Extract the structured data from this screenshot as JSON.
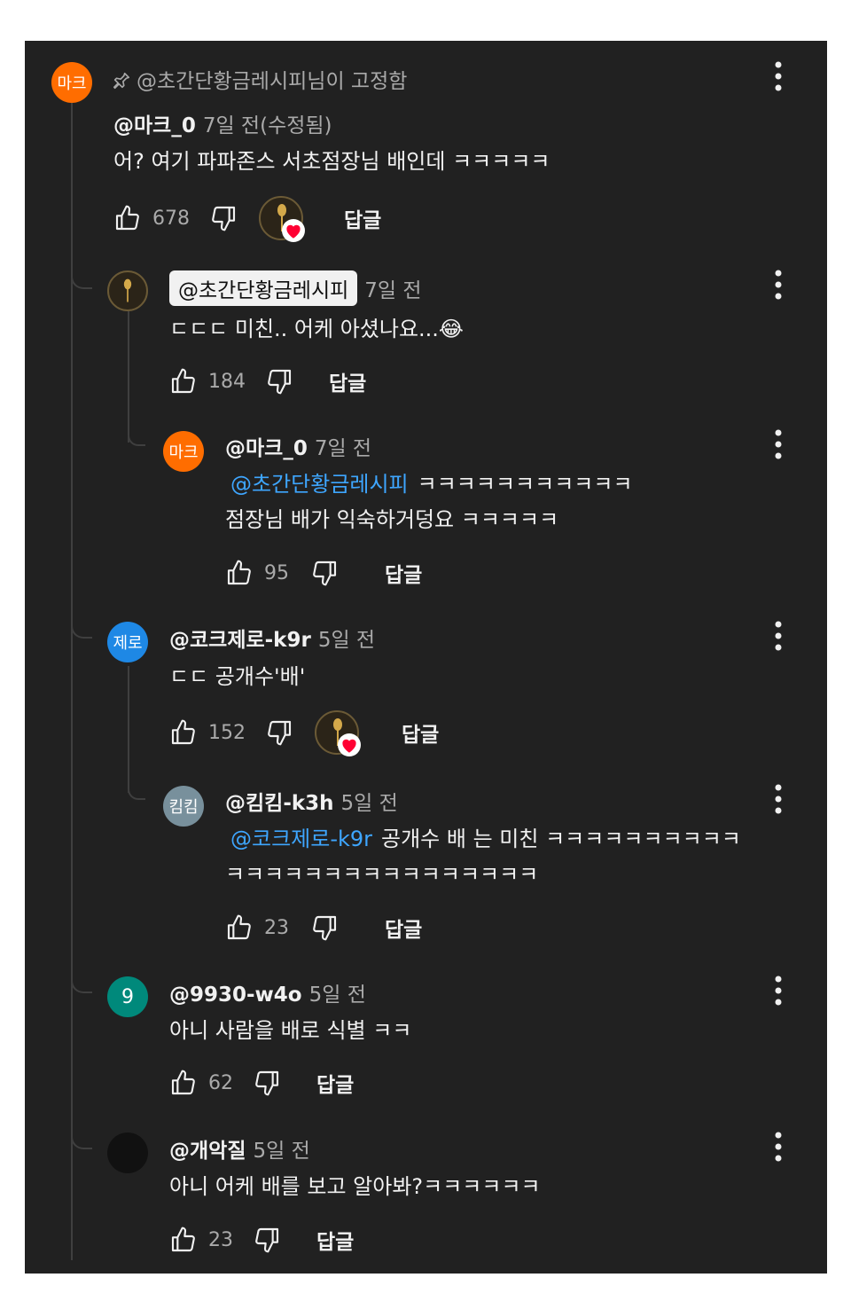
{
  "pinned": {
    "text": "@초간단황금레시피님이 고정함"
  },
  "comments": [
    {
      "avatar_text": "마크",
      "avatar_color": "#ff6d00",
      "handle": "@마크_0",
      "time": "7일 전(수정됨)",
      "text": "어? 여기 파파존스 서초점장님 배인데 ㅋㅋㅋㅋㅋ",
      "likes": "678",
      "reply_label": "답글",
      "creator_heart": true
    },
    {
      "avatar_text": "",
      "avatar_color": "#2b2418",
      "handle": "@초간단황금레시피",
      "time": "7일 전",
      "text": "ㄷㄷㄷ 미친.. 어케 아셨나요...😂",
      "likes": "184",
      "reply_label": "답글",
      "creator_heart": false
    },
    {
      "avatar_text": "마크",
      "avatar_color": "#ff6d00",
      "handle": "@마크_0",
      "time": "7일 전",
      "mention": "@초간단황금레시피",
      "text_line1": "ㅋㅋㅋㅋㅋㅋㅋㅋㅋㅋㅋ",
      "text_line2": "점장님 배가 익숙하거덩요 ㅋㅋㅋㅋㅋ",
      "likes": "95",
      "reply_label": "답글",
      "creator_heart": false
    },
    {
      "avatar_text": "제로",
      "avatar_color": "#1e88e5",
      "handle": "@코크제로-k9r",
      "time": "5일 전",
      "text": "ㄷㄷ 공개수'배'",
      "likes": "152",
      "reply_label": "답글",
      "creator_heart": true
    },
    {
      "avatar_text": "킴킴",
      "avatar_color": "#78909c",
      "handle": "@킴킴-k3h",
      "time": "5일 전",
      "mention": "@코크제로-k9r",
      "text_line1": "공개수 배 는 미친 ㅋㅋㅋㅋㅋㅋㅋㅋㅋㅋ",
      "text_line2": "ㅋㅋㅋㅋㅋㅋㅋㅋㅋㅋㅋㅋㅋㅋㅋㅋ",
      "likes": "23",
      "reply_label": "답글",
      "creator_heart": false
    },
    {
      "avatar_text": "9",
      "avatar_color": "#00897b",
      "handle": "@9930-w4o",
      "time": "5일 전",
      "text": "아니 사람을 배로 식별 ㅋㅋ",
      "likes": "62",
      "reply_label": "답글",
      "creator_heart": false
    },
    {
      "avatar_text": "",
      "avatar_color": "#111111",
      "handle": "@개악질",
      "time": "5일 전",
      "text": "아니 어케 배를 보고 알아봐?ㅋㅋㅋㅋㅋㅋ",
      "likes": "23",
      "reply_label": "답글",
      "creator_heart": false
    }
  ],
  "colors": {
    "background": "#212121",
    "text": "#f1f1f1",
    "muted": "#aaaaaa",
    "mention": "#3ea6ff",
    "heart": "#ff0033"
  },
  "icons": [
    "pin-icon",
    "thumb-up-icon",
    "thumb-down-icon",
    "more-vert-icon",
    "creator-heart-icon"
  ]
}
